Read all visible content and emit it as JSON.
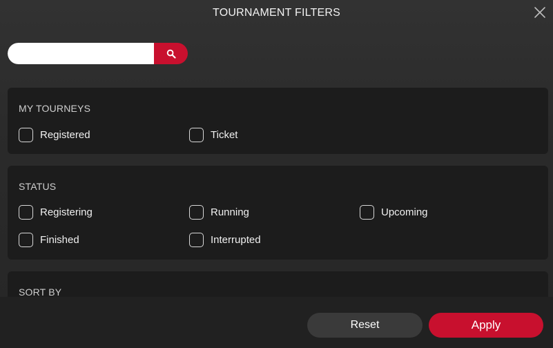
{
  "header": {
    "title": "TOURNAMENT FILTERS",
    "close_icon": "close-icon"
  },
  "search": {
    "value": "",
    "placeholder": "",
    "button_icon": "search-icon"
  },
  "sections": {
    "my_tourneys": {
      "title": "MY TOURNEYS",
      "options": [
        "Registered",
        "Ticket"
      ]
    },
    "status": {
      "title": "STATUS",
      "options": [
        "Registering",
        "Running",
        "Upcoming",
        "Finished",
        "Interrupted"
      ]
    },
    "sort_by": {
      "title": "SORT BY"
    }
  },
  "footer": {
    "reset_label": "Reset",
    "apply_label": "Apply"
  },
  "colors": {
    "accent": "#c8102e",
    "panel": "#1c1c1c",
    "background": "#2c2c2c",
    "reset_button": "#3a3a3a"
  }
}
